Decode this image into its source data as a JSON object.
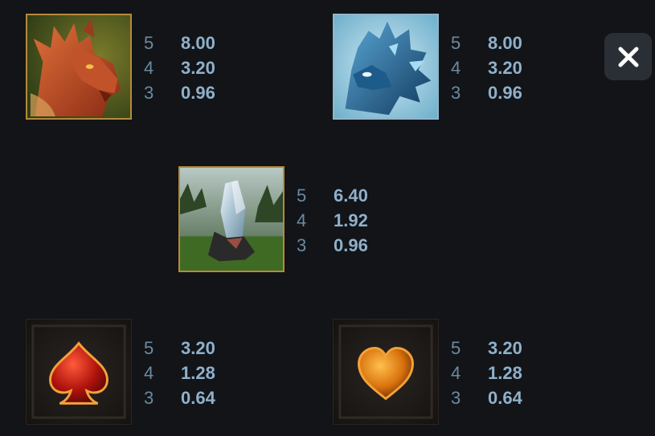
{
  "paytable": {
    "symbols": [
      {
        "name": "red-dragon",
        "payouts": [
          {
            "count": "5",
            "value": "8.00"
          },
          {
            "count": "4",
            "value": "3.20"
          },
          {
            "count": "3",
            "value": "0.96"
          }
        ]
      },
      {
        "name": "blue-dragon",
        "payouts": [
          {
            "count": "5",
            "value": "8.00"
          },
          {
            "count": "4",
            "value": "3.20"
          },
          {
            "count": "3",
            "value": "0.96"
          }
        ]
      },
      {
        "name": "crystal",
        "payouts": [
          {
            "count": "5",
            "value": "6.40"
          },
          {
            "count": "4",
            "value": "1.92"
          },
          {
            "count": "3",
            "value": "0.96"
          }
        ]
      },
      {
        "name": "spade",
        "payouts": [
          {
            "count": "5",
            "value": "3.20"
          },
          {
            "count": "4",
            "value": "1.28"
          },
          {
            "count": "3",
            "value": "0.64"
          }
        ]
      },
      {
        "name": "heart",
        "payouts": [
          {
            "count": "5",
            "value": "3.20"
          },
          {
            "count": "4",
            "value": "1.28"
          },
          {
            "count": "3",
            "value": "0.64"
          }
        ]
      }
    ]
  },
  "close_button": {
    "icon": "close-icon"
  },
  "colors": {
    "background": "#121417",
    "count_text": "#6b8aa3",
    "value_text": "#8fb0cb",
    "close_bg": "#2a2f36"
  }
}
